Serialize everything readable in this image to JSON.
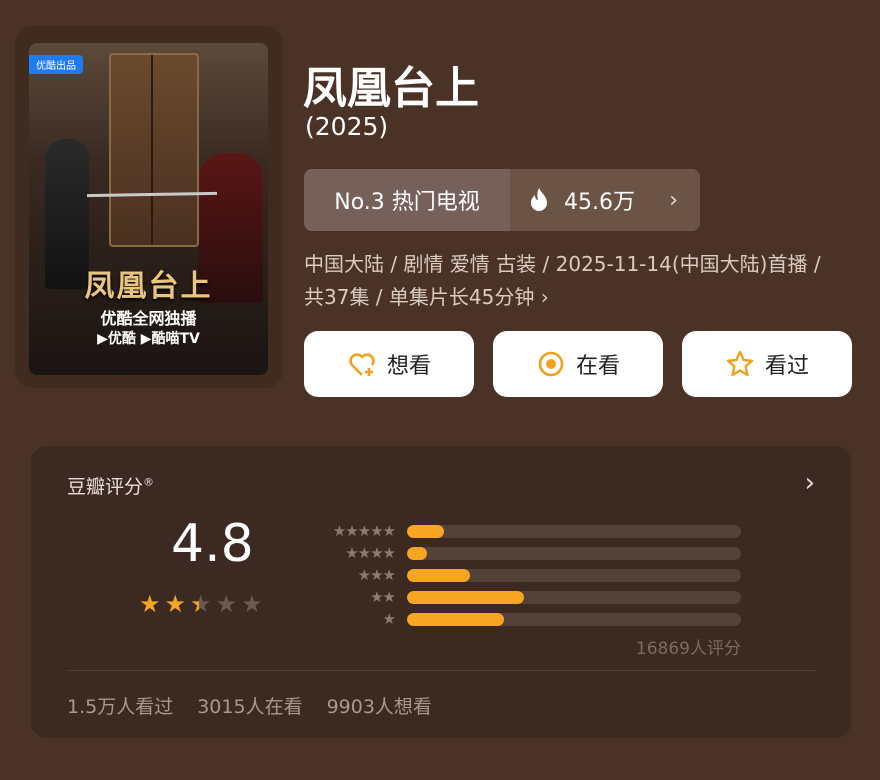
{
  "poster": {
    "badge": "优酷出品",
    "title": "凤凰台上",
    "subtitle": "优酷全网独播",
    "platforms": "▶优酷 ▶酷喵TV"
  },
  "title": "凤凰台上",
  "year": "(2025)",
  "rank": {
    "label": "No.3 热门电视",
    "heat_icon": "flame-icon",
    "heat": "45.6万",
    "chevron": "›"
  },
  "meta": "中国大陆 / 剧情 爱情 古装 / 2025-11-14(中国大陆)首播 / 共37集 / 单集片长45分钟 ›",
  "actions": [
    {
      "label": "想看",
      "icon": "heart-plus-icon"
    },
    {
      "label": "在看",
      "icon": "target-circle-icon"
    },
    {
      "label": "看过",
      "icon": "star-outline-icon"
    }
  ],
  "rating": {
    "label": "豆瓣评分",
    "reg": "®",
    "chevron": "›",
    "score": "4.8",
    "stars_filled_fraction": 0.48,
    "distribution": [
      {
        "stars": "★★★★★",
        "fraction": 0.11
      },
      {
        "stars": "★★★★",
        "fraction": 0.06
      },
      {
        "stars": "★★★",
        "fraction": 0.19
      },
      {
        "stars": "★★",
        "fraction": 0.35
      },
      {
        "stars": "★",
        "fraction": 0.29
      }
    ],
    "count": "16869人评分",
    "colors": {
      "accent": "#f6a623",
      "track": "#54423a"
    }
  },
  "stats": {
    "watched": "1.5万人看过",
    "watching": "3015人在看",
    "wish": "9903人想看"
  }
}
